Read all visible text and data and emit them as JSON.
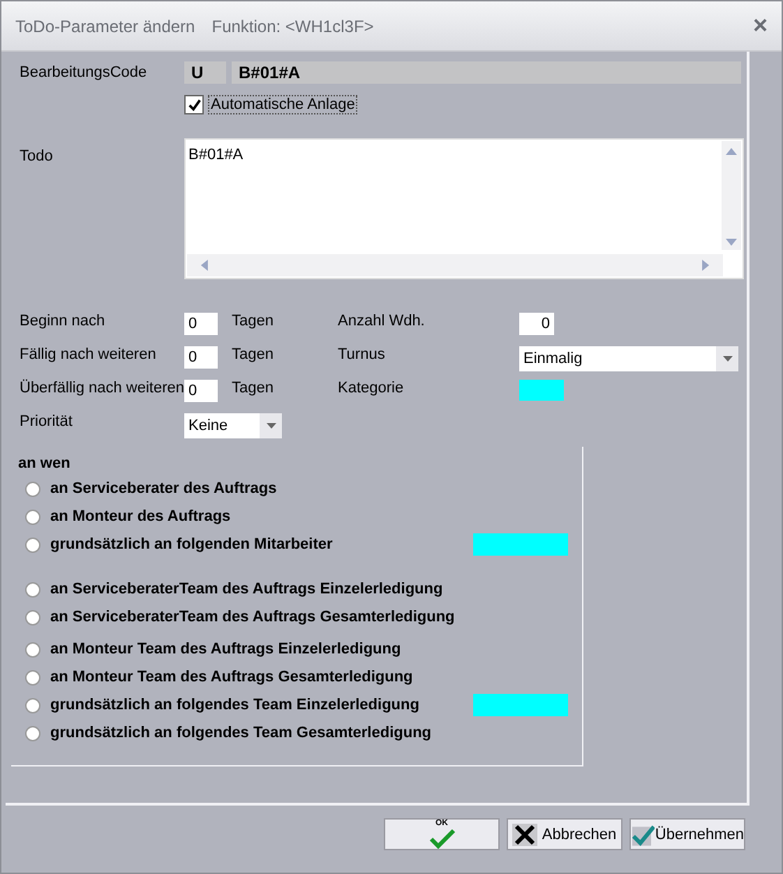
{
  "window": {
    "title": "ToDo-Parameter ändern",
    "subtitle": "Funktion: <WH1cl3F>",
    "close": "×"
  },
  "code": {
    "label": "BearbeitungsCode",
    "mode": "U",
    "value": "B#01#A"
  },
  "auto": {
    "label": "Automatische Anlage",
    "checked": true
  },
  "todo": {
    "label": "Todo",
    "value": "B#01#A"
  },
  "params": [
    {
      "label": "Beginn  nach",
      "value": "0",
      "unit": "Tagen"
    },
    {
      "label": "Fällig nach weiteren",
      "value": "0",
      "unit": "Tagen"
    },
    {
      "label": "Überfällig nach weiteren",
      "value": "0",
      "unit": "Tagen"
    }
  ],
  "repeat": {
    "label": "Anzahl Wdh.",
    "value": "0"
  },
  "turnus": {
    "label": "Turnus",
    "value": "Einmalig"
  },
  "kategorie": {
    "label": "Kategorie",
    "color": "#00ffff"
  },
  "prioritaet": {
    "label": "Priorität",
    "value": "Keine"
  },
  "recipients": {
    "title": "an wen",
    "groups": [
      {
        "options": [
          {
            "label": "an Serviceberater des Auftrags",
            "selected": false
          },
          {
            "label": "an Monteur des Auftrags",
            "selected": false
          },
          {
            "label": "grundsätzlich an folgenden Mitarbeiter",
            "selected": false,
            "color": "#00ffff"
          }
        ]
      },
      {
        "options": [
          {
            "label": "an ServiceberaterTeam des Auftrags Einzelerledigung",
            "selected": false
          },
          {
            "label": "an ServiceberaterTeam des Auftrags Gesamterledigung",
            "selected": false
          }
        ]
      },
      {
        "options": [
          {
            "label": "an Monteur Team des Auftrags Einzelerledigung",
            "selected": false
          },
          {
            "label": "an Monteur Team des Auftrags Gesamterledigung",
            "selected": false
          }
        ]
      },
      {
        "options": [
          {
            "label": "grundsätzlich an folgendes Team Einzelerledigung",
            "selected": false,
            "color": "#00ffff"
          },
          {
            "label": "grundsätzlich an folgendes Team Gesamterledigung",
            "selected": false
          }
        ]
      }
    ]
  },
  "buttons": [
    {
      "kind": "ok",
      "label": "OK"
    },
    {
      "kind": "cancel",
      "label": "Abbrechen"
    },
    {
      "kind": "apply",
      "label": "Übernehmen"
    }
  ]
}
